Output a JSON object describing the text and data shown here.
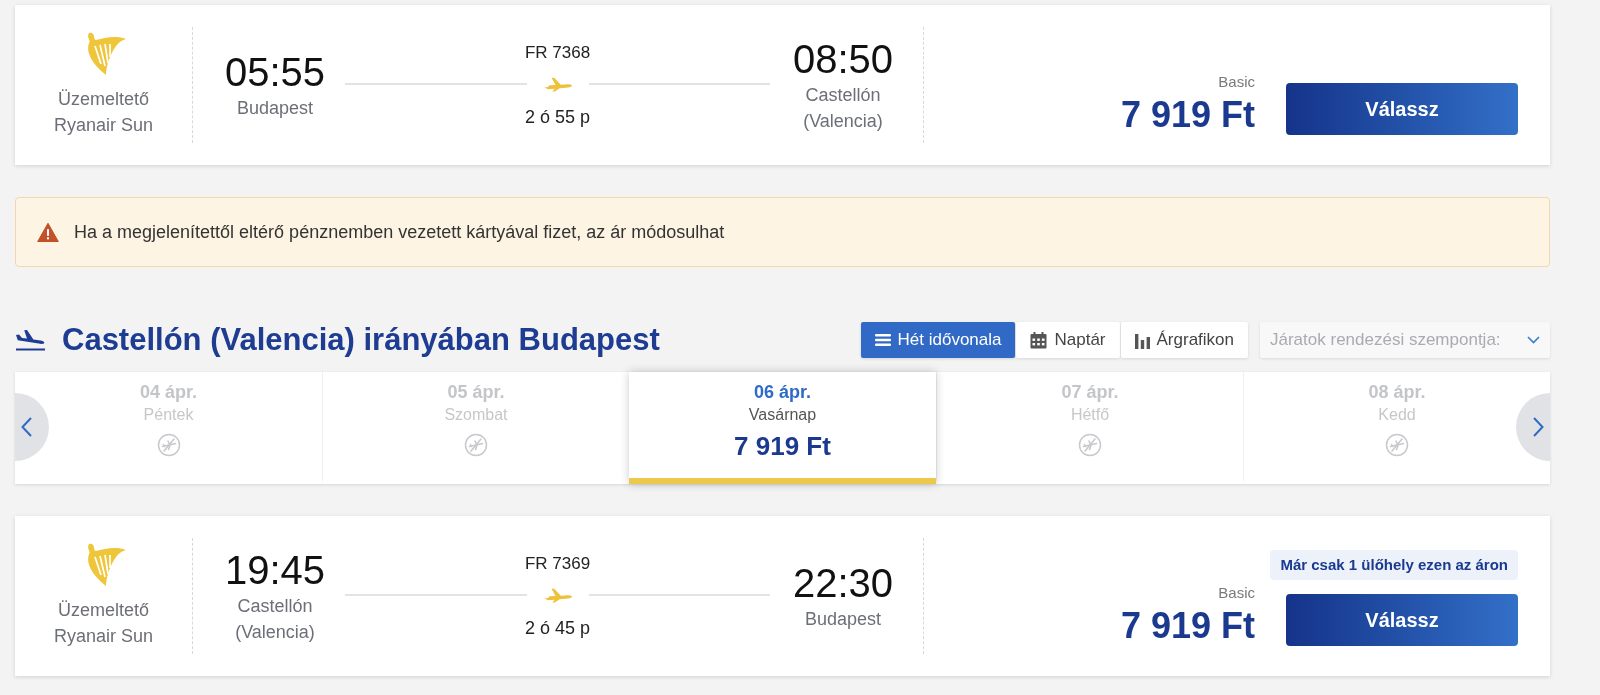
{
  "outbound_flight": {
    "operator": "Üzemeltető Ryanair Sun",
    "departure_time": "05:55",
    "departure_city": "Budapest",
    "flight_number": "FR 7368",
    "duration": "2 ó 55 p",
    "arrival_time": "08:50",
    "arrival_city": "Castellón (Valencia)",
    "fare": "Basic",
    "price": "7 919 Ft",
    "button": "Válassz"
  },
  "notice": {
    "text": "Ha a megjelenítettől eltérő pénznemben vezetett kártyával fizet, az ár módosulhat"
  },
  "return_section": {
    "title": "Castellón (Valencia) irányában Budapest",
    "view_tabs": [
      {
        "label": "Hét idővonala",
        "kind": "timeline",
        "selected": true
      },
      {
        "label": "Naptár",
        "kind": "calendar",
        "selected": false
      },
      {
        "label": "Árgrafikon",
        "kind": "chart",
        "selected": false
      }
    ],
    "sort": {
      "placeholder": "Járatok rendezési szempontja:"
    },
    "dates": [
      {
        "date": "04 ápr.",
        "day": "Péntek",
        "selected": false
      },
      {
        "date": "05 ápr.",
        "day": "Szombat",
        "selected": false
      },
      {
        "date": "06 ápr.",
        "day": "Vasárnap",
        "price": "7 919 Ft",
        "selected": true
      },
      {
        "date": "07 ápr.",
        "day": "Hétfő",
        "selected": false
      },
      {
        "date": "08 ápr.",
        "day": "Kedd",
        "selected": false
      }
    ],
    "flights": [
      {
        "operator": "Üzemeltető Ryanair Sun",
        "departure_time": "19:45",
        "departure_city": "Castellón (Valencia)",
        "flight_number": "FR 7369",
        "duration": "2 ó 45 p",
        "arrival_time": "22:30",
        "arrival_city": "Budapest",
        "badge": "Már csak 1 ülőhely ezen az áron",
        "fare": "Basic",
        "price": "7 919 Ft",
        "button": "Válassz"
      }
    ]
  }
}
